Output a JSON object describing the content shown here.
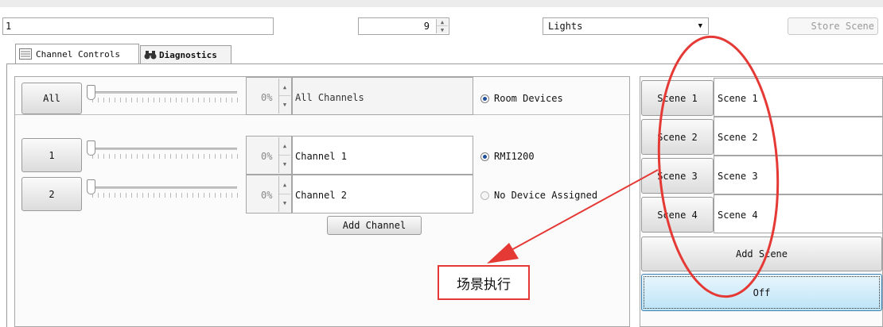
{
  "form": {
    "name_value": "1",
    "id_value": "9",
    "type_value": "Lights",
    "store_scene_label": "Store Scene"
  },
  "tabs": [
    {
      "label": "Channel Controls",
      "icon": "channel-controls-icon",
      "active": true
    },
    {
      "label": "Diagnostics",
      "icon": "binoculars-icon",
      "active": false
    }
  ],
  "all_row": {
    "button": "All",
    "percent": "0%",
    "channel_name": "All Channels",
    "radio_label": "Room Devices",
    "radio_selected": true
  },
  "channels": [
    {
      "button": "1",
      "percent": "0%",
      "name": "Channel 1",
      "radio_label": "RMI1200",
      "radio_selected": true
    },
    {
      "button": "2",
      "percent": "0%",
      "name": "Channel 2",
      "radio_label": "No Device Assigned",
      "radio_selected": false
    }
  ],
  "add_channel_label": "Add Channel",
  "scenes": [
    {
      "button": "Scene 1",
      "name": "Scene 1"
    },
    {
      "button": "Scene 2",
      "name": "Scene 2"
    },
    {
      "button": "Scene 3",
      "name": "Scene 3"
    },
    {
      "button": "Scene 4",
      "name": "Scene 4"
    }
  ],
  "add_scene_label": "Add Scene",
  "off_label": "Off",
  "annotation": {
    "text": "场景执行",
    "color": "#e53935"
  }
}
